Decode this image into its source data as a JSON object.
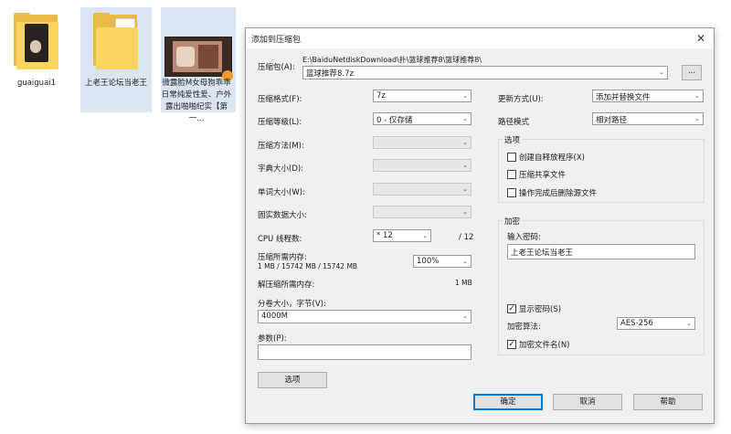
{
  "desktop": {
    "icons": [
      {
        "label": "guaiguai1",
        "icon": "folder-icon"
      },
      {
        "label": "上老王论坛当老王",
        "icon": "folder-icon"
      },
      {
        "label": "微露脸M女母狗乖乖日常纯爱性爱、户外露出啪啪纪实【第一...",
        "icon": "video-file-icon"
      }
    ]
  },
  "dialog": {
    "title": "添加到压缩包",
    "close": "✕",
    "archive_label": "压缩包(A):",
    "archive_path": "E:\\BaiduNetdiskDownload\\扑\\篮球推荐8\\篮球推荐8\\",
    "archive_name": "篮球推荐8.7z",
    "browse_label": "...",
    "left": {
      "format_label": "压缩格式(F):",
      "format_value": "7z",
      "level_label": "压缩等级(L):",
      "level_value": "0 - 仅存储",
      "method_label": "压缩方法(M):",
      "dict_label": "字典大小(D):",
      "word_label": "单词大小(W):",
      "solid_label": "固实数据大小:",
      "cpu_label": "CPU 线程数:",
      "cpu_value": "* 12",
      "cpu_max": "/ 12",
      "mem_label": "压缩所需内存:",
      "mem_value": "1 MB / 15742 MB / 15742 MB",
      "mem_percent": "100%",
      "decomp_label": "解压缩所需内存:",
      "decomp_value": "1 MB",
      "split_label": "分卷大小，字节(V):",
      "split_value": "4000M",
      "param_label": "参数(P):",
      "param_value": "",
      "options_button": "选项"
    },
    "right": {
      "update_label": "更新方式(U):",
      "update_value": "添加并替换文件",
      "path_label": "路径模式",
      "path_value": "相对路径",
      "options_group": "选项",
      "opt_sfx": "创建自释放程序(X)",
      "opt_shared": "压缩共享文件",
      "opt_delete": "操作完成后删除源文件",
      "encrypt_group": "加密",
      "password_label": "输入密码:",
      "password_value": "上老王论坛当老王",
      "show_password": "显示密码(S)",
      "algo_label": "加密算法:",
      "algo_value": "AES-256",
      "encrypt_names": "加密文件名(N)"
    },
    "buttons": {
      "ok": "确定",
      "cancel": "取消",
      "help": "帮助"
    },
    "check_mark": "✓",
    "arrow": "⌄"
  }
}
